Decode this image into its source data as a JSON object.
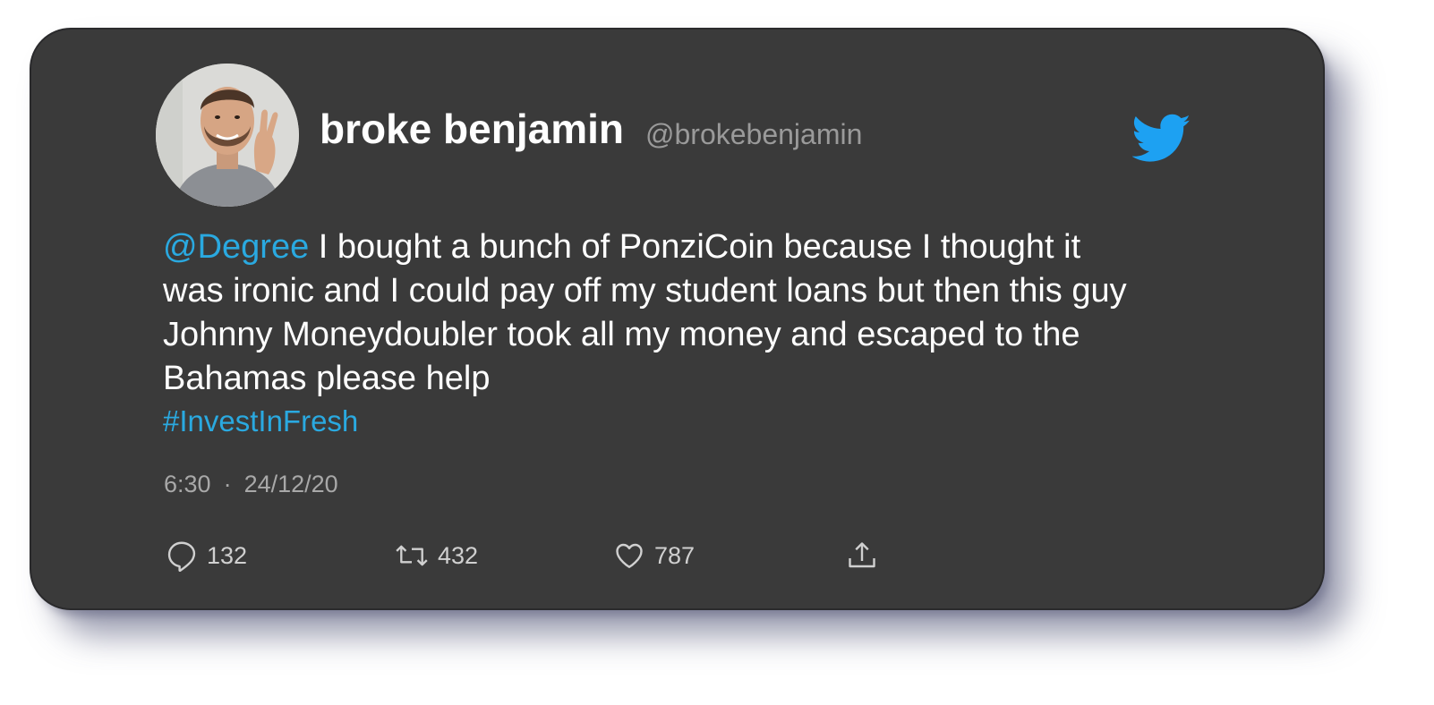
{
  "user": {
    "display_name": "broke benjamin",
    "handle": "@brokebenjamin"
  },
  "tweet": {
    "mention": "@Degree",
    "body": " I bought a bunch of PonziCoin because I thought it was ironic and I could pay off my student loans but then this guy Johnny Moneydoubler took all my money and escaped to the Bahamas please help",
    "hashtag": "#InvestInFresh",
    "time": "6:30",
    "separator": "·",
    "date": "24/12/20"
  },
  "actions": {
    "replies": "132",
    "retweets": "432",
    "likes": "787"
  },
  "icons": {
    "brand": "twitter-bird-icon",
    "reply": "reply-icon",
    "retweet": "retweet-icon",
    "like": "heart-icon",
    "share": "share-icon"
  },
  "colors": {
    "card_background": "#3a3a3a",
    "accent": "#2aa9e0",
    "twitter_blue": "#1da1f2",
    "muted_text": "#9a9a9a"
  }
}
